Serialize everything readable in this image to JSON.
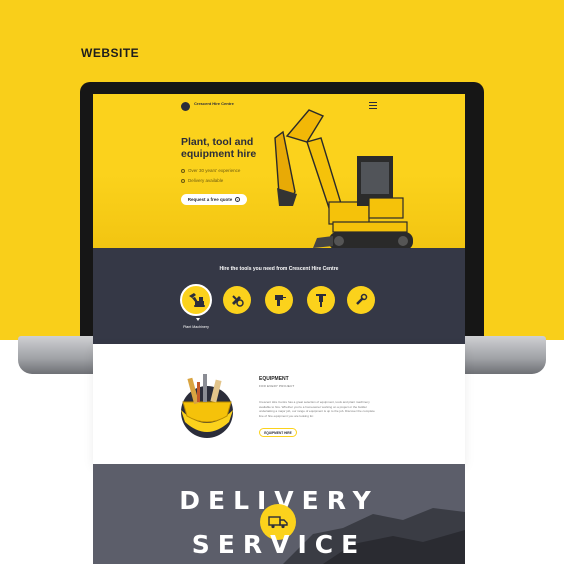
{
  "page": {
    "heading": "WEBSITE"
  },
  "site": {
    "logo_text": "Crescent Hire Centre",
    "hero": {
      "title": "Plant, tool and equipment hire",
      "bullets": [
        "Over 30 years' experience",
        "Delivery available"
      ],
      "cta": "Request a free quote"
    },
    "categories_title": "Hire the tools you need from Crescent Hire Centre",
    "categories": [
      {
        "label": "Plant Machinery",
        "icon": "excavator-icon",
        "active": true
      },
      {
        "label": "",
        "icon": "tools-icon",
        "active": false
      },
      {
        "label": "",
        "icon": "drill-icon",
        "active": false
      },
      {
        "label": "",
        "icon": "jackhammer-icon",
        "active": false
      },
      {
        "label": "",
        "icon": "wrench-icon",
        "active": false
      }
    ],
    "equipment": {
      "title": "EQUIPMENT",
      "subtitle": "FOR EVERY PROJECT",
      "body": "Crescent Hire Centre has a great selection of equipment, tools and plant machinery available to hire. Whether you're a homeowner working on a project or the builder undertaking a major job, our range of equipment is up to the job. Discover the complete line of hire equipment you are looking for.",
      "link": "EQUIPMENT HIRE"
    },
    "delivery": {
      "line1": "DELIVERY",
      "line2": "SERVICE"
    }
  },
  "colors": {
    "accent": "#f9cf1a",
    "dark": "#353846",
    "delivery_bg": "#5c5e6a"
  }
}
